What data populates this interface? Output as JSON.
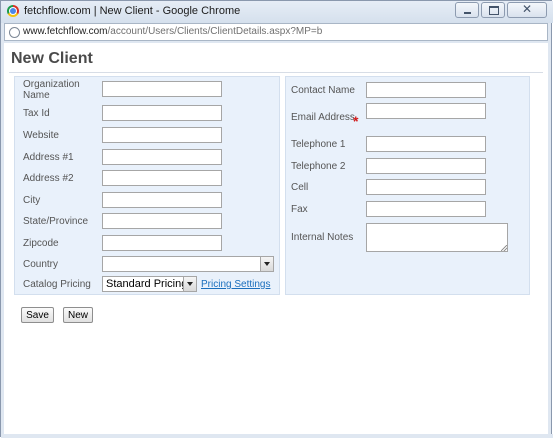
{
  "window": {
    "title": "fetchflow.com | New Client - Google Chrome",
    "close_glyph": "✕"
  },
  "address": {
    "host": "www.fetchflow.com",
    "path": "/account/Users/Clients/ClientDetails.aspx?MP=b"
  },
  "page": {
    "title": "New Client"
  },
  "form_left": {
    "organization_name_label": "Organization Name",
    "tax_id_label": "Tax Id",
    "website_label": "Website",
    "address1_label": "Address #1",
    "address2_label": "Address #2",
    "city_label": "City",
    "state_label": "State/Province",
    "zipcode_label": "Zipcode",
    "country_label": "Country",
    "country_value": "",
    "catalog_pricing_label": "Catalog Pricing",
    "catalog_pricing_value": "Standard Pricing",
    "pricing_settings_link": "Pricing Settings"
  },
  "form_right": {
    "contact_name_label": "Contact Name",
    "email_label": "Email Address",
    "required_marker": "*",
    "telephone1_label": "Telephone 1",
    "telephone2_label": "Telephone 2",
    "cell_label": "Cell",
    "fax_label": "Fax",
    "internal_notes_label": "Internal Notes"
  },
  "actions": {
    "save_label": "Save",
    "new_label": "New"
  },
  "colors": {
    "panel_background": "#e9f1fb",
    "link": "#1a6fbd",
    "required": "#d11a1a"
  }
}
